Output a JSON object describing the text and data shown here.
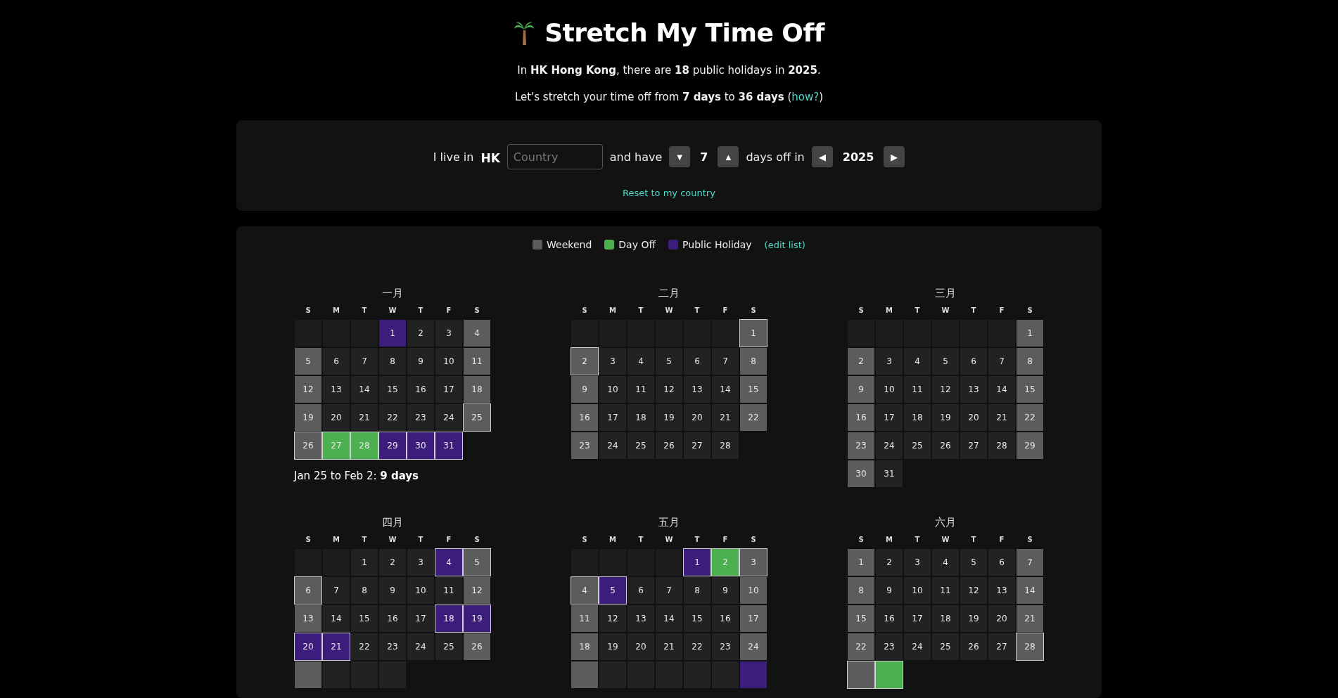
{
  "header": {
    "title": "Stretch My Time Off",
    "summary": "In **HK Hong Kong**, there are **18** public holidays in **2025**.",
    "stretch": {
      "text": "Let's stretch your time off from **7 days** to **36 days** (",
      "link": "how?",
      "suffix": ")"
    }
  },
  "controls": {
    "live_label": "I live in",
    "country_code": "HK",
    "country_placeholder": "Country",
    "have_label": "and have",
    "decrement": "▼",
    "days": "7",
    "increment": "▲",
    "days_label": "days off in",
    "prev_year": "◀",
    "year": "2025",
    "next_year": "▶",
    "reset_link": "Reset to my country"
  },
  "legend": {
    "items": [
      {
        "label": "Weekend",
        "color": "#5a5a5a"
      },
      {
        "label": "Day Off",
        "color": "#4caf50"
      },
      {
        "label": "Public Holiday",
        "color": "#3c1d7c"
      }
    ],
    "edit_link": "(edit list)"
  },
  "months": [
    {
      "title": "一月",
      "weekdays": [
        "S",
        "M",
        "T",
        "W",
        "T",
        "F",
        "S"
      ],
      "weeks": [
        [
          {
            "kind": "blank"
          },
          {
            "kind": "blank"
          },
          {
            "kind": "blank"
          },
          {
            "day": "1",
            "kind": "holiday",
            "outlined": false
          },
          {
            "day": "2",
            "kind": "work",
            "outlined": false
          },
          {
            "day": "3",
            "kind": "work",
            "outlined": false
          },
          {
            "day": "4",
            "kind": "weekend",
            "outlined": false
          }
        ],
        [
          {
            "day": "5",
            "kind": "weekend",
            "outlined": false
          },
          {
            "day": "6",
            "kind": "work",
            "outlined": false
          },
          {
            "day": "7",
            "kind": "work",
            "outlined": false
          },
          {
            "day": "8",
            "kind": "work",
            "outlined": false
          },
          {
            "day": "9",
            "kind": "work",
            "outlined": false
          },
          {
            "day": "10",
            "kind": "work",
            "outlined": false
          },
          {
            "day": "11",
            "kind": "weekend",
            "outlined": false
          }
        ],
        [
          {
            "day": "12",
            "kind": "weekend",
            "outlined": false
          },
          {
            "day": "13",
            "kind": "work",
            "outlined": false
          },
          {
            "day": "14",
            "kind": "work",
            "outlined": false
          },
          {
            "day": "15",
            "kind": "work",
            "outlined": false
          },
          {
            "day": "16",
            "kind": "work",
            "outlined": false
          },
          {
            "day": "17",
            "kind": "work",
            "outlined": false
          },
          {
            "day": "18",
            "kind": "weekend",
            "outlined": false
          }
        ],
        [
          {
            "day": "19",
            "kind": "weekend",
            "outlined": false
          },
          {
            "day": "20",
            "kind": "work",
            "outlined": false
          },
          {
            "day": "21",
            "kind": "work",
            "outlined": false
          },
          {
            "day": "22",
            "kind": "work",
            "outlined": false
          },
          {
            "day": "23",
            "kind": "work",
            "outlined": false
          },
          {
            "day": "24",
            "kind": "work",
            "outlined": false
          },
          {
            "day": "25",
            "kind": "weekend",
            "outlined": true
          }
        ],
        [
          {
            "day": "26",
            "kind": "weekend",
            "outlined": true
          },
          {
            "day": "27",
            "kind": "dayoff",
            "outlined": true
          },
          {
            "day": "28",
            "kind": "dayoff",
            "outlined": true
          },
          {
            "day": "29",
            "kind": "holiday",
            "outlined": true
          },
          {
            "day": "30",
            "kind": "holiday",
            "outlined": true
          },
          {
            "day": "31",
            "kind": "holiday",
            "outlined": true
          }
        ]
      ],
      "stretch_note": "Jan 25 to Feb 2: **9 days**"
    },
    {
      "title": "二月",
      "weekdays": [
        "S",
        "M",
        "T",
        "W",
        "T",
        "F",
        "S"
      ],
      "weeks": [
        [
          {
            "kind": "blank"
          },
          {
            "kind": "blank"
          },
          {
            "kind": "blank"
          },
          {
            "kind": "blank"
          },
          {
            "kind": "blank"
          },
          {
            "kind": "blank"
          },
          {
            "day": "1",
            "kind": "weekend",
            "outlined": true
          }
        ],
        [
          {
            "day": "2",
            "kind": "weekend",
            "outlined": true
          },
          {
            "day": "3",
            "kind": "work",
            "outlined": false
          },
          {
            "day": "4",
            "kind": "work",
            "outlined": false
          },
          {
            "day": "5",
            "kind": "work",
            "outlined": false
          },
          {
            "day": "6",
            "kind": "work",
            "outlined": false
          },
          {
            "day": "7",
            "kind": "work",
            "outlined": false
          },
          {
            "day": "8",
            "kind": "weekend",
            "outlined": false
          }
        ],
        [
          {
            "day": "9",
            "kind": "weekend",
            "outlined": false
          },
          {
            "day": "10",
            "kind": "work",
            "outlined": false
          },
          {
            "day": "11",
            "kind": "work",
            "outlined": false
          },
          {
            "day": "12",
            "kind": "work",
            "outlined": false
          },
          {
            "day": "13",
            "kind": "work",
            "outlined": false
          },
          {
            "day": "14",
            "kind": "work",
            "outlined": false
          },
          {
            "day": "15",
            "kind": "weekend",
            "outlined": false
          }
        ],
        [
          {
            "day": "16",
            "kind": "weekend",
            "outlined": false
          },
          {
            "day": "17",
            "kind": "work",
            "outlined": false
          },
          {
            "day": "18",
            "kind": "work",
            "outlined": false
          },
          {
            "day": "19",
            "kind": "work",
            "outlined": false
          },
          {
            "day": "20",
            "kind": "work",
            "outlined": false
          },
          {
            "day": "21",
            "kind": "work",
            "outlined": false
          },
          {
            "day": "22",
            "kind": "weekend",
            "outlined": false
          }
        ],
        [
          {
            "day": "23",
            "kind": "weekend",
            "outlined": false
          },
          {
            "day": "24",
            "kind": "work",
            "outlined": false
          },
          {
            "day": "25",
            "kind": "work",
            "outlined": false
          },
          {
            "day": "26",
            "kind": "work",
            "outlined": false
          },
          {
            "day": "27",
            "kind": "work",
            "outlined": false
          },
          {
            "day": "28",
            "kind": "work",
            "outlined": false
          }
        ]
      ]
    },
    {
      "title": "三月",
      "weekdays": [
        "S",
        "M",
        "T",
        "W",
        "T",
        "F",
        "S"
      ],
      "weeks": [
        [
          {
            "kind": "blank"
          },
          {
            "kind": "blank"
          },
          {
            "kind": "blank"
          },
          {
            "kind": "blank"
          },
          {
            "kind": "blank"
          },
          {
            "kind": "blank"
          },
          {
            "day": "1",
            "kind": "weekend",
            "outlined": false
          }
        ],
        [
          {
            "day": "2",
            "kind": "weekend",
            "outlined": false
          },
          {
            "day": "3",
            "kind": "work",
            "outlined": false
          },
          {
            "day": "4",
            "kind": "work",
            "outlined": false
          },
          {
            "day": "5",
            "kind": "work",
            "outlined": false
          },
          {
            "day": "6",
            "kind": "work",
            "outlined": false
          },
          {
            "day": "7",
            "kind": "work",
            "outlined": false
          },
          {
            "day": "8",
            "kind": "weekend",
            "outlined": false
          }
        ],
        [
          {
            "day": "9",
            "kind": "weekend",
            "outlined": false
          },
          {
            "day": "10",
            "kind": "work",
            "outlined": false
          },
          {
            "day": "11",
            "kind": "work",
            "outlined": false
          },
          {
            "day": "12",
            "kind": "work",
            "outlined": false
          },
          {
            "day": "13",
            "kind": "work",
            "outlined": false
          },
          {
            "day": "14",
            "kind": "work",
            "outlined": false
          },
          {
            "day": "15",
            "kind": "weekend",
            "outlined": false
          }
        ],
        [
          {
            "day": "16",
            "kind": "weekend",
            "outlined": false
          },
          {
            "day": "17",
            "kind": "work",
            "outlined": false
          },
          {
            "day": "18",
            "kind": "work",
            "outlined": false
          },
          {
            "day": "19",
            "kind": "work",
            "outlined": false
          },
          {
            "day": "20",
            "kind": "work",
            "outlined": false
          },
          {
            "day": "21",
            "kind": "work",
            "outlined": false
          },
          {
            "day": "22",
            "kind": "weekend",
            "outlined": false
          }
        ],
        [
          {
            "day": "23",
            "kind": "weekend",
            "outlined": false
          },
          {
            "day": "24",
            "kind": "work",
            "outlined": false
          },
          {
            "day": "25",
            "kind": "work",
            "outlined": false
          },
          {
            "day": "26",
            "kind": "work",
            "outlined": false
          },
          {
            "day": "27",
            "kind": "work",
            "outlined": false
          },
          {
            "day": "28",
            "kind": "work",
            "outlined": false
          },
          {
            "day": "29",
            "kind": "weekend",
            "outlined": false
          }
        ],
        [
          {
            "day": "30",
            "kind": "weekend",
            "outlined": false
          },
          {
            "day": "31",
            "kind": "work",
            "outlined": false
          }
        ]
      ]
    },
    {
      "title": "四月",
      "weekdays": [
        "S",
        "M",
        "T",
        "W",
        "T",
        "F",
        "S"
      ],
      "weeks": [
        [
          {
            "kind": "blank"
          },
          {
            "kind": "blank"
          },
          {
            "day": "1",
            "kind": "work",
            "outlined": false
          },
          {
            "day": "2",
            "kind": "work",
            "outlined": false
          },
          {
            "day": "3",
            "kind": "work",
            "outlined": false
          },
          {
            "day": "4",
            "kind": "holiday",
            "outlined": true
          },
          {
            "day": "5",
            "kind": "weekend",
            "outlined": true
          }
        ],
        [
          {
            "day": "6",
            "kind": "weekend",
            "outlined": true
          },
          {
            "day": "7",
            "kind": "work",
            "outlined": false
          },
          {
            "day": "8",
            "kind": "work",
            "outlined": false
          },
          {
            "day": "9",
            "kind": "work",
            "outlined": false
          },
          {
            "day": "10",
            "kind": "work",
            "outlined": false
          },
          {
            "day": "11",
            "kind": "work",
            "outlined": false
          },
          {
            "day": "12",
            "kind": "weekend",
            "outlined": false
          }
        ],
        [
          {
            "day": "13",
            "kind": "weekend",
            "outlined": false
          },
          {
            "day": "14",
            "kind": "work",
            "outlined": false
          },
          {
            "day": "15",
            "kind": "work",
            "outlined": false
          },
          {
            "day": "16",
            "kind": "work",
            "outlined": false
          },
          {
            "day": "17",
            "kind": "work",
            "outlined": false
          },
          {
            "day": "18",
            "kind": "holiday",
            "outlined": true
          },
          {
            "day": "19",
            "kind": "holiday",
            "outlined": true
          }
        ],
        [
          {
            "day": "20",
            "kind": "holiday",
            "outlined": true
          },
          {
            "day": "21",
            "kind": "holiday",
            "outlined": true
          },
          {
            "day": "22",
            "kind": "work",
            "outlined": false
          },
          {
            "day": "23",
            "kind": "work",
            "outlined": false
          },
          {
            "day": "24",
            "kind": "work",
            "outlined": false
          },
          {
            "day": "25",
            "kind": "work",
            "outlined": false
          },
          {
            "day": "26",
            "kind": "weekend",
            "outlined": false
          }
        ],
        [
          {
            "kind": "weekend",
            "outlined": false
          },
          {
            "kind": "work",
            "outlined": false
          },
          {
            "kind": "work",
            "outlined": false
          },
          {
            "kind": "work",
            "outlined": false
          }
        ]
      ]
    },
    {
      "title": "五月",
      "weekdays": [
        "S",
        "M",
        "T",
        "W",
        "T",
        "F",
        "S"
      ],
      "weeks": [
        [
          {
            "kind": "blank"
          },
          {
            "kind": "blank"
          },
          {
            "kind": "blank"
          },
          {
            "kind": "blank"
          },
          {
            "day": "1",
            "kind": "holiday",
            "outlined": true
          },
          {
            "day": "2",
            "kind": "dayoff",
            "outlined": true
          },
          {
            "day": "3",
            "kind": "weekend",
            "outlined": true
          }
        ],
        [
          {
            "day": "4",
            "kind": "weekend",
            "outlined": true
          },
          {
            "day": "5",
            "kind": "holiday",
            "outlined": true
          },
          {
            "day": "6",
            "kind": "work",
            "outlined": false
          },
          {
            "day": "7",
            "kind": "work",
            "outlined": false
          },
          {
            "day": "8",
            "kind": "work",
            "outlined": false
          },
          {
            "day": "9",
            "kind": "work",
            "outlined": false
          },
          {
            "day": "10",
            "kind": "weekend",
            "outlined": false
          }
        ],
        [
          {
            "day": "11",
            "kind": "weekend",
            "outlined": false
          },
          {
            "day": "12",
            "kind": "work",
            "outlined": false
          },
          {
            "day": "13",
            "kind": "work",
            "outlined": false
          },
          {
            "day": "14",
            "kind": "work",
            "outlined": false
          },
          {
            "day": "15",
            "kind": "work",
            "outlined": false
          },
          {
            "day": "16",
            "kind": "work",
            "outlined": false
          },
          {
            "day": "17",
            "kind": "weekend",
            "outlined": false
          }
        ],
        [
          {
            "day": "18",
            "kind": "weekend",
            "outlined": false
          },
          {
            "day": "19",
            "kind": "work",
            "outlined": false
          },
          {
            "day": "20",
            "kind": "work",
            "outlined": false
          },
          {
            "day": "21",
            "kind": "work",
            "outlined": false
          },
          {
            "day": "22",
            "kind": "work",
            "outlined": false
          },
          {
            "day": "23",
            "kind": "work",
            "outlined": false
          },
          {
            "day": "24",
            "kind": "weekend",
            "outlined": false
          }
        ],
        [
          {
            "kind": "weekend",
            "outlined": false
          },
          {
            "kind": "work",
            "outlined": false
          },
          {
            "kind": "work",
            "outlined": false
          },
          {
            "kind": "work",
            "outlined": false
          },
          {
            "kind": "work",
            "outlined": false
          },
          {
            "kind": "work",
            "outlined": false
          },
          {
            "kind": "holiday",
            "outlined": false
          }
        ]
      ]
    },
    {
      "title": "六月",
      "weekdays": [
        "S",
        "M",
        "T",
        "W",
        "T",
        "F",
        "S"
      ],
      "weeks": [
        [
          {
            "day": "1",
            "kind": "weekend",
            "outlined": false
          },
          {
            "day": "2",
            "kind": "work",
            "outlined": false
          },
          {
            "day": "3",
            "kind": "work",
            "outlined": false
          },
          {
            "day": "4",
            "kind": "work",
            "outlined": false
          },
          {
            "day": "5",
            "kind": "work",
            "outlined": false
          },
          {
            "day": "6",
            "kind": "work",
            "outlined": false
          },
          {
            "day": "7",
            "kind": "weekend",
            "outlined": false
          }
        ],
        [
          {
            "day": "8",
            "kind": "weekend",
            "outlined": false
          },
          {
            "day": "9",
            "kind": "work",
            "outlined": false
          },
          {
            "day": "10",
            "kind": "work",
            "outlined": false
          },
          {
            "day": "11",
            "kind": "work",
            "outlined": false
          },
          {
            "day": "12",
            "kind": "work",
            "outlined": false
          },
          {
            "day": "13",
            "kind": "work",
            "outlined": false
          },
          {
            "day": "14",
            "kind": "weekend",
            "outlined": false
          }
        ],
        [
          {
            "day": "15",
            "kind": "weekend",
            "outlined": false
          },
          {
            "day": "16",
            "kind": "work",
            "outlined": false
          },
          {
            "day": "17",
            "kind": "work",
            "outlined": false
          },
          {
            "day": "18",
            "kind": "work",
            "outlined": false
          },
          {
            "day": "19",
            "kind": "work",
            "outlined": false
          },
          {
            "day": "20",
            "kind": "work",
            "outlined": false
          },
          {
            "day": "21",
            "kind": "weekend",
            "outlined": false
          }
        ],
        [
          {
            "day": "22",
            "kind": "weekend",
            "outlined": false
          },
          {
            "day": "23",
            "kind": "work",
            "outlined": false
          },
          {
            "day": "24",
            "kind": "work",
            "outlined": false
          },
          {
            "day": "25",
            "kind": "work",
            "outlined": false
          },
          {
            "day": "26",
            "kind": "work",
            "outlined": false
          },
          {
            "day": "27",
            "kind": "work",
            "outlined": false
          },
          {
            "day": "28",
            "kind": "weekend",
            "outlined": true
          }
        ],
        [
          {
            "kind": "weekend",
            "outlined": true
          },
          {
            "kind": "dayoff",
            "outlined": true
          }
        ]
      ]
    }
  ]
}
